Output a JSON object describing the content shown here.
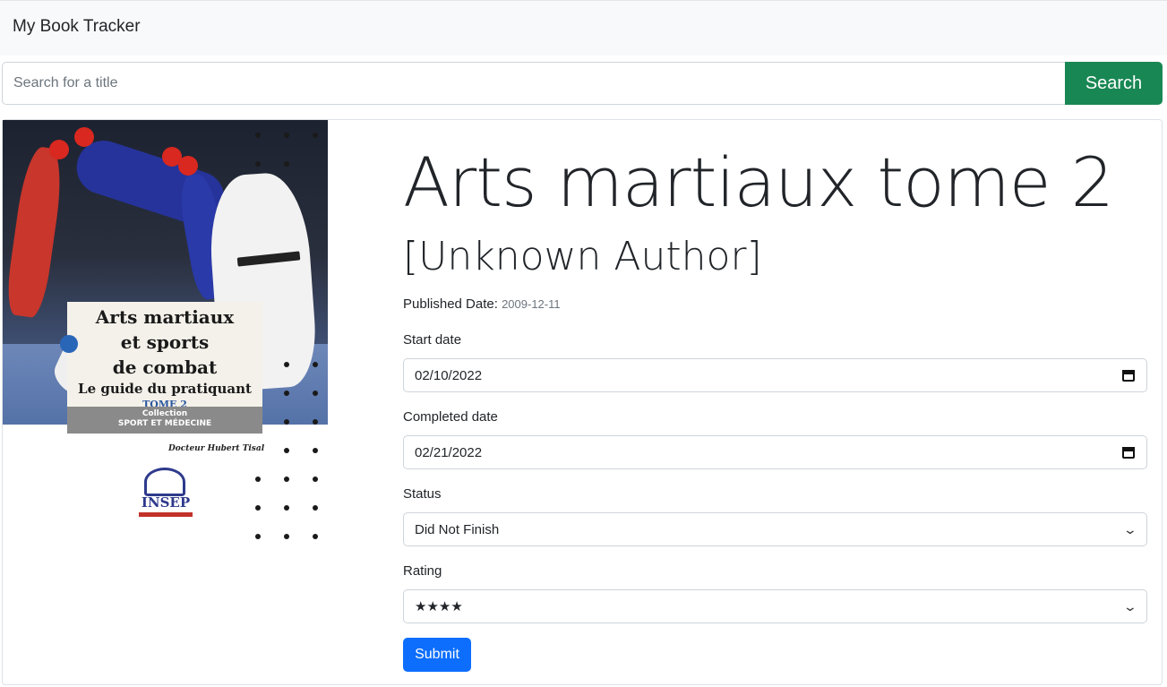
{
  "navbar": {
    "brand": "My Book Tracker"
  },
  "search": {
    "placeholder": "Search for a title",
    "value": "",
    "button_label": "Search"
  },
  "cover": {
    "title_line1": "Arts martiaux",
    "title_line2": "et sports",
    "title_line3": "de combat",
    "subtitle": "Le guide du pratiquant",
    "volume": "TOME 2",
    "collection": "Collection",
    "collection_name": "SPORT ET MÉDECINE",
    "author": "Docteur Hubert Tisal",
    "publisher_logo": "INSEP"
  },
  "book": {
    "title": "Arts martiaux tome 2",
    "author": "[Unknown Author]",
    "published_label": "Published Date:",
    "published_value": "2009-12-11"
  },
  "form": {
    "start_label": "Start date",
    "start_value": "02/10/2022",
    "completed_label": "Completed date",
    "completed_value": "02/21/2022",
    "status_label": "Status",
    "status_value": "Did Not Finish",
    "rating_label": "Rating",
    "rating_value": "★★★★",
    "submit_label": "Submit"
  },
  "icons": {
    "calendar": "calendar-icon",
    "chevron": "chevron-down-icon"
  },
  "colors": {
    "search_button": "#198754",
    "submit_button": "#0d6efd",
    "navbar_bg": "#f8f9fa"
  }
}
